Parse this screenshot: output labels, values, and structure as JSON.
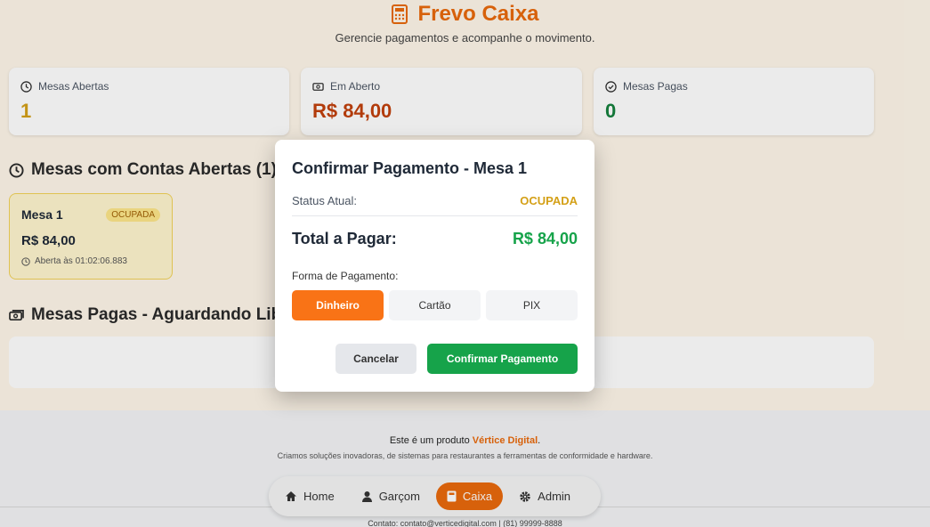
{
  "header": {
    "title": "Frevo Caixa",
    "subtitle": "Gerencie pagamentos e acompanhe o movimento."
  },
  "stats": [
    {
      "label": "Mesas Abertas",
      "value": "1",
      "color": "#d4a017",
      "icon": "clock-icon"
    },
    {
      "label": "Em Aberto",
      "value": "R$ 84,00",
      "color": "#c2410c",
      "icon": "money-icon"
    },
    {
      "label": "Mesas Pagas",
      "value": "0",
      "color": "#15803d",
      "icon": "check-circle-icon"
    }
  ],
  "open_section": {
    "title": "Mesas com Contas Abertas (1)",
    "tables": [
      {
        "name": "Mesa 1",
        "status": "OCUPADA",
        "total": "R$ 84,00",
        "opened": "Aberta às 01:02:06.883"
      }
    ]
  },
  "paid_section": {
    "title": "Mesas Pagas - Aguardando Libe"
  },
  "footer": {
    "line1_prefix": "Este é um produto ",
    "brand": "Vértice Digital",
    "line1_suffix": ".",
    "line2": "Criamos soluções inovadoras, de sistemas para restaurantes a ferramentas de conformidade e hardware.",
    "line3": "Contato: contato@verticedigital.com | (81) 99999-8888"
  },
  "nav": [
    {
      "label": "Home",
      "icon": "home-icon",
      "active": false
    },
    {
      "label": "Garçom",
      "icon": "user-icon",
      "active": false
    },
    {
      "label": "Caixa",
      "icon": "calculator-icon",
      "active": true
    },
    {
      "label": "Admin",
      "icon": "gear-icon",
      "active": false
    }
  ],
  "modal": {
    "title": "Confirmar Pagamento - Mesa 1",
    "status_label": "Status Atual:",
    "status_value": "OCUPADA",
    "total_label": "Total a Pagar:",
    "total_value": "R$ 84,00",
    "method_label": "Forma de Pagamento:",
    "methods": [
      "Dinheiro",
      "Cartão",
      "PIX"
    ],
    "selected_method": "Dinheiro",
    "cancel": "Cancelar",
    "confirm": "Confirmar Pagamento"
  },
  "colors": {
    "accent": "#ea6a0c",
    "success": "#16a34a",
    "warning": "#d4a017"
  }
}
